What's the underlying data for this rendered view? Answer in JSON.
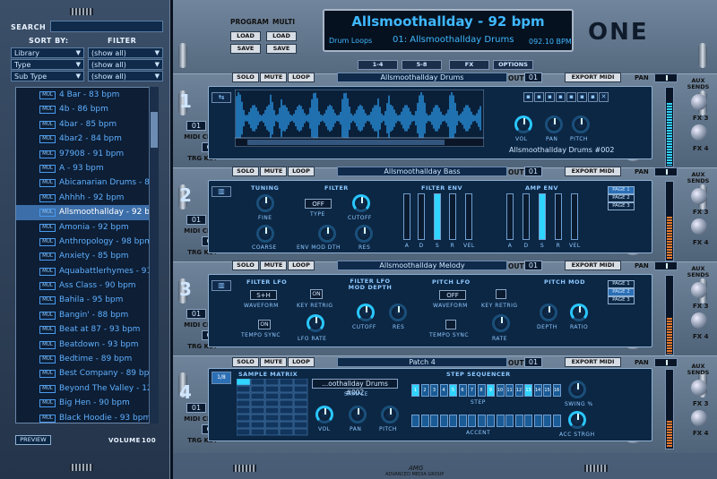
{
  "left": {
    "search_label": "SEARCH",
    "sort_label": "SORT BY:",
    "filter_label": "FILTER",
    "sorts": [
      {
        "field": "Library",
        "filter": "(show all)"
      },
      {
        "field": "Type",
        "filter": "(show all)"
      },
      {
        "field": "Sub Type",
        "filter": "(show all)"
      }
    ],
    "list": [
      {
        "tag": "MUL",
        "name": "4 Bar - 83 bpm"
      },
      {
        "tag": "MUL",
        "name": "4b - 86 bpm"
      },
      {
        "tag": "MUL",
        "name": "4bar - 85 bpm"
      },
      {
        "tag": "MUL",
        "name": "4bar2 - 84 bpm"
      },
      {
        "tag": "MUL",
        "name": "97908 - 91 bpm"
      },
      {
        "tag": "MUL",
        "name": "A - 93 bpm"
      },
      {
        "tag": "MUL",
        "name": "Abicanarian Drums - 84"
      },
      {
        "tag": "MUL",
        "name": "Ahhhh - 92 bpm"
      },
      {
        "tag": "MUL",
        "name": "Allsmoothallday - 92 bp"
      },
      {
        "tag": "MUL",
        "name": "Amonia - 92 bpm"
      },
      {
        "tag": "MUL",
        "name": "Anthropology - 98 bpm"
      },
      {
        "tag": "MUL",
        "name": "Anxiety - 85 bpm"
      },
      {
        "tag": "MUL",
        "name": "Aquabattlerhymes - 91 l"
      },
      {
        "tag": "MUL",
        "name": "Ass Class - 90 bpm"
      },
      {
        "tag": "MUL",
        "name": "Bahila - 95 bpm"
      },
      {
        "tag": "MUL",
        "name": "Bangin' - 88 bpm"
      },
      {
        "tag": "MUL",
        "name": "Beat at 87 - 93 bpm"
      },
      {
        "tag": "MUL",
        "name": "Beatdown - 93 bpm"
      },
      {
        "tag": "MUL",
        "name": "Bedtime - 89 bpm"
      },
      {
        "tag": "MUL",
        "name": "Best Company - 89 bpm"
      },
      {
        "tag": "MUL",
        "name": "Beyond The Valley - 12"
      },
      {
        "tag": "MUL",
        "name": "Big Hen - 90 bpm"
      },
      {
        "tag": "MUL",
        "name": "Black Hoodie - 93 bpm"
      }
    ],
    "selected_index": 8,
    "preview": "PREVIEW",
    "volume_label": "VOLUME",
    "volume_value": "100"
  },
  "top": {
    "program_label": "PROGRAM",
    "multi_label": "MULTI",
    "load": "LOAD",
    "save": "SAVE",
    "title": "Allsmoothallday - 92 bpm",
    "category": "Drum Loops",
    "patch": "01: Allsmoothallday Drums",
    "tempo": "092.10 BPM",
    "logo": "ONE",
    "tabs": [
      "1-4",
      "5-8",
      "FX",
      "OPTIONS"
    ]
  },
  "slots": [
    {
      "num": "1",
      "name": "Allsmoothallday Drums",
      "out": "01",
      "midi": "01",
      "key": "C3",
      "extra": "Allsmoothallday Drums #002",
      "solo": "SOLO",
      "mute": "MUTE",
      "loop": "LOOP",
      "export": "EXPORT MIDI"
    },
    {
      "num": "2",
      "name": "Allsmoothallday Bass",
      "out": "01",
      "midi": "01",
      "key": "C3",
      "solo": "SOLO",
      "mute": "MUTE",
      "loop": "LOOP",
      "export": "EXPORT MIDI"
    },
    {
      "num": "3",
      "name": "Allsmoothallday Melody",
      "out": "01",
      "midi": "01",
      "key": "C3",
      "solo": "SOLO",
      "mute": "MUTE",
      "loop": "LOOP",
      "export": "EXPORT MIDI"
    },
    {
      "num": "4",
      "name": "Patch 4",
      "out": "01",
      "midi": "01",
      "key": "C3",
      "solo": "SOLO",
      "mute": "MUTE",
      "loop": "LOOP",
      "export": "EXPORT MIDI"
    }
  ],
  "labels": {
    "out": "OUT",
    "midi_ch": "MIDI CH",
    "trg_key": "TRG KEY",
    "pan": "PAN",
    "vol": "VOL",
    "aux": "AUX SENDS",
    "fx3": "FX 3",
    "fx4": "FX 4",
    "s1": {
      "vol": "VOL",
      "pan": "PAN",
      "pitch": "PITCH"
    },
    "s2": {
      "tuning": "TUNING",
      "fine": "FINE",
      "coarse": "COARSE",
      "filter": "FILTER",
      "type": "TYPE",
      "type_val": "OFF",
      "cutoff": "CUTOFF",
      "env_mod": "ENV MOD DTH",
      "res": "RES",
      "filter_env": "FILTER ENV",
      "amp_env": "AMP ENV",
      "adsr": [
        "A",
        "D",
        "S",
        "R",
        "VEL"
      ],
      "pages": [
        "PAGE 1",
        "PAGE 2",
        "PAGE 3"
      ]
    },
    "s3": {
      "filter_lfo": "FILTER LFO",
      "waveform": "WAVEFORM",
      "wave_val": "S+H",
      "key_retrig": "KEY RETRIG",
      "on": "ON",
      "tempo_sync": "TEMPO SYNC",
      "lfo_rate": "LFO RATE",
      "filter_lfo_mod": "FILTER LFO MOD DEPTH",
      "cutoff": "CUTOFF",
      "res": "RES",
      "pitch_lfo": "PITCH LFO",
      "pwave": "WAVEFORM",
      "pwave_val": "OFF",
      "pkey": "KEY RETRIG",
      "ptempo": "TEMPO SYNC",
      "rate": "RATE",
      "pitch_mod": "PITCH MOD",
      "depth": "DEPTH",
      "ratio": "RATIO",
      "pages": [
        "PAGE 1",
        "PAGE 2",
        "PAGE 3"
      ]
    },
    "s4": {
      "sample_matrix": "SAMPLE MATRIX",
      "sample_val": "...oothallday Drums #002",
      "sample": "SAMPLE",
      "vol": "VOL",
      "pan": "PAN",
      "pitch": "PITCH",
      "step_seq": "STEP SEQUENCER",
      "step": "STEP",
      "accent": "ACCENT",
      "swing": "SWING %",
      "acc_strgh": "ACC STRGH",
      "matrix_mode": "1/8"
    }
  },
  "steps": [
    "1",
    "2",
    "3",
    "4",
    "5",
    "6",
    "7",
    "8",
    "9",
    "10",
    "11",
    "12",
    "13",
    "14",
    "15",
    "16"
  ],
  "active_steps": [
    1,
    5,
    9,
    13
  ],
  "brand": "ADVANCED MEDIA GROUP"
}
